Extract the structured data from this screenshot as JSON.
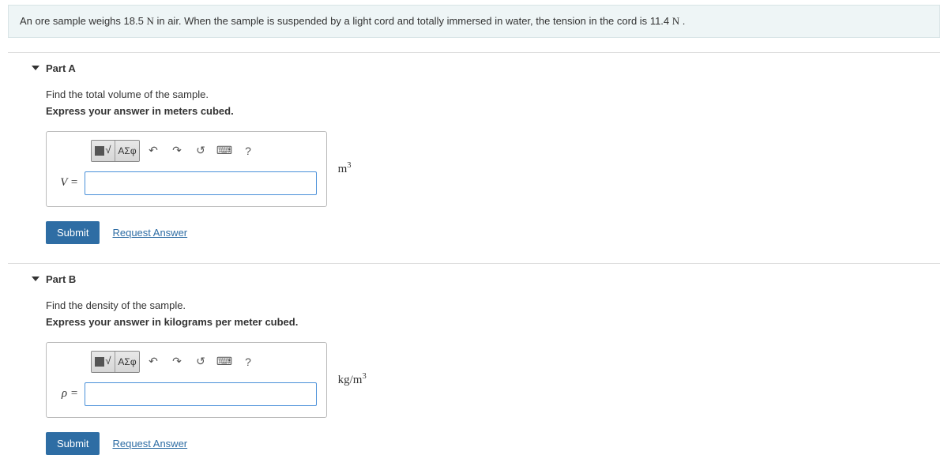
{
  "problem": {
    "text_before_w1": "An ore sample weighs ",
    "weight1": "18.5",
    "unit_n1": "N",
    "text_mid": " in air. When the sample is suspended by a light cord and totally immersed in water, the tension in the cord is ",
    "weight2": "11.4",
    "unit_n2": "N",
    "text_end": " ."
  },
  "parts": [
    {
      "title": "Part A",
      "prompt": "Find the total volume of the sample.",
      "instruction": "Express your answer in meters cubed.",
      "var_label": "V =",
      "unit_html": "m³",
      "toolbar": {
        "symbols": "ΑΣφ",
        "help": "?"
      },
      "submit": "Submit",
      "request": "Request Answer"
    },
    {
      "title": "Part B",
      "prompt": "Find the density of the sample.",
      "instruction": "Express your answer in kilograms per meter cubed.",
      "var_label": "ρ =",
      "unit_html": "kg/m³",
      "toolbar": {
        "symbols": "ΑΣφ",
        "help": "?"
      },
      "submit": "Submit",
      "request": "Request Answer"
    }
  ]
}
